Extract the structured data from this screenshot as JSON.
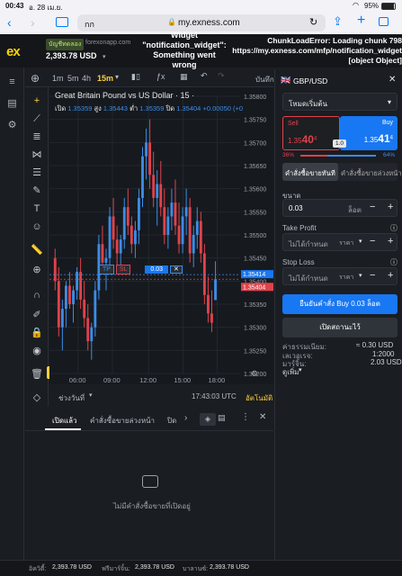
{
  "status_bar": {
    "time": "00:43",
    "date": "อ. 28 เม.ย.",
    "battery": "95%"
  },
  "safari": {
    "aa": "กก",
    "url": "my.exness.com",
    "lock_icon": "lock-icon"
  },
  "header": {
    "logo": "ex",
    "badge": "บัญชีทดลอง",
    "server": "forexonapp.com",
    "balance": "2,393.78 USD",
    "error_widget": "Widget\n\"notification_widget\":\nSomething went\nwrong",
    "error_chunk": "ChunkLoadError: Loading chunk 798\nhttps://my.exness.com/mfp/notification_widget\n[object Object]"
  },
  "chart_toolbar": {
    "timeframes": [
      "1m",
      "5m",
      "4h",
      "15m"
    ],
    "active": "15m",
    "label_right": "บันทึก"
  },
  "chart_header": {
    "title": "Great Britain Pound vs US Dollar · 15 ·",
    "open_label": "เปิด",
    "open": "1.35359",
    "high_label": "สูง",
    "high": "1.35443",
    "low_label": "ต่ำ",
    "low": "1.35359",
    "close_label": "ปิด",
    "close": "1.35404",
    "change": "+0.00050 (+0"
  },
  "chart_data": {
    "type": "candlestick",
    "y_ticks": [
      "1.35800",
      "1.35750",
      "1.35700",
      "1.35650",
      "1.35600",
      "1.35550",
      "1.35500",
      "1.35450",
      "1.35400",
      "1.35350",
      "1.35300",
      "1.35250",
      "1.35200"
    ],
    "ylim": [
      1.352,
      1.358
    ],
    "x_ticks": [
      "06:00",
      "09:00",
      "12:00",
      "15:00",
      "18:00"
    ],
    "price_labels": {
      "ask": "1.35414",
      "bid": "1.35404"
    },
    "position_line": {
      "tp": "TP",
      "sl": "SL",
      "lots": "0.03"
    },
    "candles": [
      [
        1.3545,
        1.3547,
        1.3538,
        1.354
      ],
      [
        1.354,
        1.3543,
        1.3528,
        1.353
      ],
      [
        1.353,
        1.3536,
        1.3525,
        1.3534
      ],
      [
        1.3534,
        1.354,
        1.353,
        1.3539
      ],
      [
        1.3539,
        1.3542,
        1.3534,
        1.3535
      ],
      [
        1.3535,
        1.3539,
        1.3531,
        1.3538
      ],
      [
        1.3538,
        1.3543,
        1.3536,
        1.3542
      ],
      [
        1.3542,
        1.3545,
        1.3534,
        1.3536
      ],
      [
        1.3536,
        1.354,
        1.353,
        1.3532
      ],
      [
        1.3532,
        1.3535,
        1.3525,
        1.3527
      ],
      [
        1.3527,
        1.3531,
        1.3523,
        1.353
      ],
      [
        1.353,
        1.354,
        1.3528,
        1.3538
      ],
      [
        1.3538,
        1.355,
        1.3536,
        1.3548
      ],
      [
        1.3548,
        1.3552,
        1.3542,
        1.3544
      ],
      [
        1.3544,
        1.3547,
        1.3538,
        1.3545
      ],
      [
        1.3545,
        1.3556,
        1.3543,
        1.3554
      ],
      [
        1.3554,
        1.3558,
        1.3547,
        1.3549
      ],
      [
        1.3549,
        1.3552,
        1.3543,
        1.3546
      ],
      [
        1.3546,
        1.355,
        1.3542,
        1.3549
      ],
      [
        1.3549,
        1.3558,
        1.3547,
        1.3556
      ],
      [
        1.3556,
        1.356,
        1.355,
        1.3552
      ],
      [
        1.3552,
        1.3554,
        1.3546,
        1.3548
      ],
      [
        1.3548,
        1.3553,
        1.3545,
        1.3551
      ],
      [
        1.3551,
        1.356,
        1.3548,
        1.3558
      ],
      [
        1.3558,
        1.3569,
        1.3556,
        1.3567
      ],
      [
        1.3567,
        1.3573,
        1.3562,
        1.357
      ],
      [
        1.357,
        1.3575,
        1.356,
        1.3563
      ],
      [
        1.3563,
        1.3568,
        1.3556,
        1.3558
      ],
      [
        1.3558,
        1.3564,
        1.3552,
        1.3561
      ],
      [
        1.3561,
        1.3566,
        1.3554,
        1.3556
      ],
      [
        1.3556,
        1.356,
        1.3548,
        1.355
      ],
      [
        1.355,
        1.3556,
        1.3547,
        1.3554
      ],
      [
        1.3554,
        1.356,
        1.3551,
        1.3557
      ],
      [
        1.3557,
        1.3562,
        1.355,
        1.3552
      ],
      [
        1.3552,
        1.3557,
        1.3546,
        1.3548
      ],
      [
        1.3548,
        1.3556,
        1.3546,
        1.3554
      ],
      [
        1.3554,
        1.356,
        1.355,
        1.3556
      ],
      [
        1.3556,
        1.3558,
        1.3544,
        1.3546
      ],
      [
        1.3546,
        1.3552,
        1.3543,
        1.355
      ],
      [
        1.355,
        1.3556,
        1.3547,
        1.3553
      ],
      [
        1.3553,
        1.3555,
        1.3544,
        1.3546
      ],
      [
        1.3546,
        1.3548,
        1.3535,
        1.3537
      ],
      [
        1.3537,
        1.3541,
        1.3531,
        1.3533
      ],
      [
        1.3533,
        1.3538,
        1.3529,
        1.3531
      ],
      [
        1.35359,
        1.35443,
        1.35359,
        1.35404
      ]
    ],
    "colors": {
      "up": "#3c8ce7",
      "down": "#e0424b"
    }
  },
  "chart_bottom": {
    "range_label": "ช่วงวันที่",
    "time": "17:43:03 UTC",
    "auto": "อัตโนมัติ"
  },
  "order_panel": {
    "symbol": "GBP/USD",
    "mode": "โหมดเริ่มต้น",
    "sell_label": "Sell",
    "sell_price_main": "1.35",
    "sell_price_big": "40",
    "sell_price_small": "4",
    "buy_label": "Buy",
    "buy_price_main": "1.35",
    "buy_price_big": "41",
    "buy_price_small": "4",
    "spread": "1.0",
    "sentiment_sell": "36%",
    "sentiment_buy": "64%",
    "tab_market": "คำสั่งซื้อขายทันที",
    "tab_pending": "คำสั่งซื้อขายล่วงหน้า",
    "volume_label": "ขนาด",
    "volume_value": "0.03",
    "volume_unit": "ล็อต",
    "tp_label": "Take Profit",
    "tp_value": "ไม่ได้กำหนด",
    "tp_unit": "ราคา",
    "sl_label": "Stop Loss",
    "sl_value": "ไม่ได้กำหนด",
    "sl_unit": "ราคา",
    "confirm_button": "ยืนยันคำสั่ง Buy 0.03 ล็อต",
    "cancel_button": "เปิดสถานะไว้",
    "fee_label": "ค่าธรรมเนียม:",
    "fee_value": "≈ 0.30 USD",
    "leverage_label": "เลเวอเรจ:",
    "leverage_value": "1:2000",
    "margin_label": "มาร์จิ้น:",
    "margin_value": "2.03 USD",
    "more_label": "ดูเพิ่ม"
  },
  "bottom_panel": {
    "tab_open": "เปิดแล้ว",
    "tab_pending": "คำสั่งซื้อขายล่วงหน้า",
    "tab_closed": "ปิด",
    "empty_text": "ไม่มีคำสั่งซื้อขายที่เปิดอยู่"
  },
  "footer": {
    "equity_label": "อิควิตี้:",
    "equity": "2,393.78 USD",
    "free_margin_label": "ฟรีมาร์จิ้น:",
    "free_margin": "2,393.78 USD",
    "balance_label": "บาลานซ์:",
    "balance": "2,393.78 USD"
  }
}
